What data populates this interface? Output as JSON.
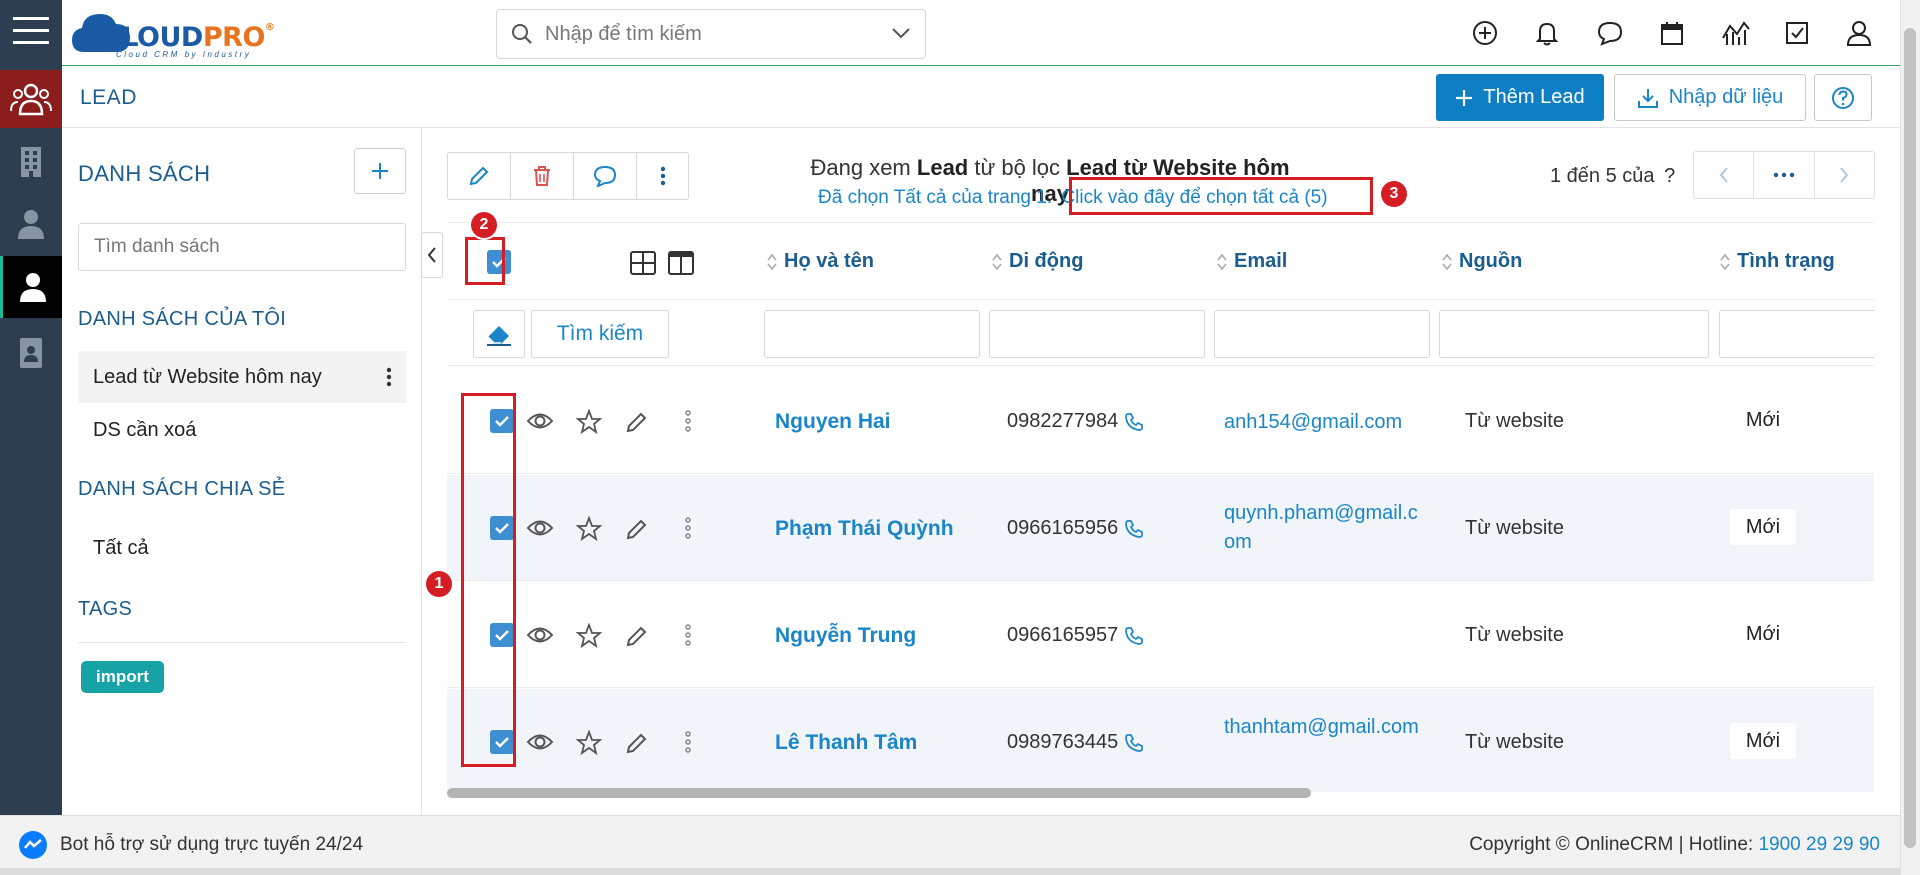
{
  "app": {
    "brand_a": "CLOUD",
    "brand_b": "PRO",
    "tagline": "Cloud CRM by Industry",
    "brand_mark": "®"
  },
  "search": {
    "placeholder": "Nhập để tìm kiếm"
  },
  "page": {
    "title": "LEAD",
    "add_button": "Thêm Lead",
    "import_button": "Nhập dữ liệu"
  },
  "sidebar": {
    "heading": "DANH SÁCH",
    "search_placeholder": "Tìm danh sách",
    "my_lists_heading": "DANH SÁCH CỦA TÔI",
    "my_lists": [
      "Lead từ Website hôm nay",
      "DS cần xoá"
    ],
    "shared_heading": "DANH SÁCH CHIA SẺ",
    "shared_lists": [
      "Tất cả"
    ],
    "tags_heading": "TAGS",
    "tags": [
      "import"
    ]
  },
  "main": {
    "filter_prefix": "Đang xem",
    "filter_module": "Lead",
    "filter_middle": "từ bộ lọc",
    "filter_name": "Lead từ Website hôm nay",
    "selected_text": "Đã chọn Tất cả của trang 1.",
    "select_all_link": "Click vào đây để chọn tất cả (5)",
    "pager_text": "1 đến 5 của",
    "pager_unknown": "?",
    "search_button": "Tìm kiếm",
    "columns": [
      "Họ và tên",
      "Di động",
      "Email",
      "Nguồn",
      "Tình trạng"
    ],
    "rows": [
      {
        "name": "Nguyen Hai",
        "phone": "0982277984",
        "email": "anh154@gmail.com",
        "source": "Từ website",
        "status": "Mới"
      },
      {
        "name": "Phạm Thái Quỳnh",
        "phone": "0966165956",
        "email": "quynh.pham@gmail.com",
        "source": "Từ website",
        "status": "Mới"
      },
      {
        "name": "Nguyễn Trung",
        "phone": "0966165957",
        "email": "",
        "source": "Từ website",
        "status": "Mới"
      },
      {
        "name": "Lê Thanh Tâm",
        "phone": "0989763445",
        "email": "thanhtam@gmail.com",
        "source": "Từ website",
        "status": "Mới"
      }
    ]
  },
  "annotations": {
    "badge1": "1",
    "badge2": "2",
    "badge3": "3"
  },
  "footer": {
    "bot_text": "Bot hỗ trợ sử dụng trực tuyến 24/24",
    "copyright": "Copyright © OnlineCRM",
    "sep": "|",
    "hotline_label": "Hotline:",
    "hotline": "1900 29 29 90"
  },
  "colors": {
    "primary": "#0e7fc5",
    "link": "#1a85c9",
    "heading": "#1a5d8e",
    "rail": "#2c3e50",
    "annotation": "#d51d24",
    "tag": "#17a2a5"
  }
}
